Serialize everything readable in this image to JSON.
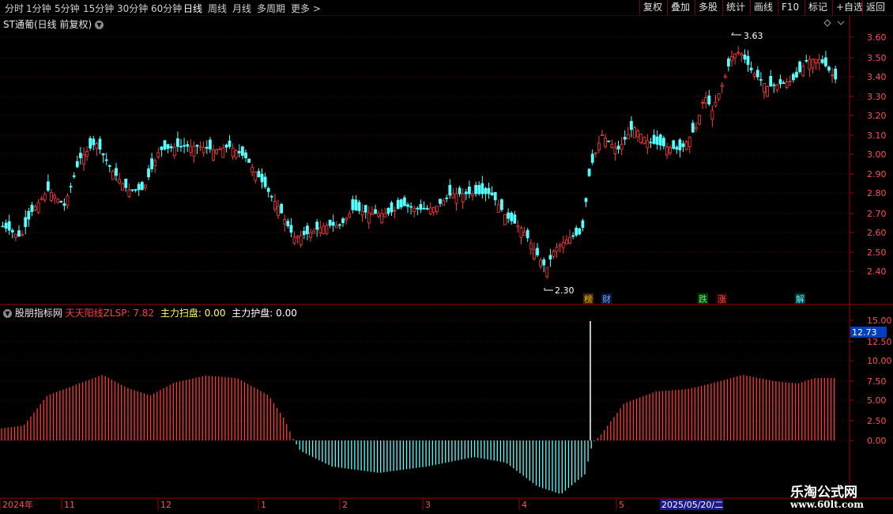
{
  "toolbar": {
    "periods": [
      "分时",
      "1分钟",
      "5分钟",
      "15分钟",
      "30分钟",
      "60分钟",
      "日线",
      "周线",
      "月线",
      "多周期",
      "更多"
    ],
    "active_period": "日线",
    "right_buttons": [
      "复权",
      "叠加",
      "多股",
      "统计",
      "画线",
      "F10",
      "标记",
      "+自选",
      "返回"
    ]
  },
  "price_panel": {
    "title": "ST通葡(日线 前复权)",
    "high_marker": "3.63",
    "low_marker": "2.30",
    "y_ticks": [
      "3.60",
      "3.50",
      "3.40",
      "3.30",
      "3.20",
      "3.10",
      "3.00",
      "2.90",
      "2.80",
      "2.70",
      "2.60",
      "2.50",
      "2.40"
    ],
    "event_tags": [
      "榜",
      "财",
      "跌",
      "涨",
      "解"
    ]
  },
  "indicator_panel": {
    "name": "股朋指标网",
    "series_label": "天天阳线ZLSP:",
    "series_value": "7.82",
    "sweep_label": "主力扫盘:",
    "sweep_value": "0.00",
    "protect_label": "主力护盘:",
    "protect_value": "0.00",
    "current_value_box": "12.73",
    "y_ticks": [
      "15.00",
      "12.50",
      "10.00",
      "7.50",
      "5.00",
      "2.50",
      "0.00"
    ]
  },
  "time_axis": {
    "labels": [
      "2024年",
      "11",
      "12",
      "1",
      "2",
      "3",
      "4",
      "5"
    ],
    "cursor_date": "2025/05/20/二"
  },
  "watermark": {
    "title": "乐淘公式网",
    "url": "www.60lt.com"
  },
  "colors": {
    "up": "#ff3a3a",
    "down": "#54ffff",
    "grid": "#7a0000",
    "axis_text": "#ff5050"
  }
}
